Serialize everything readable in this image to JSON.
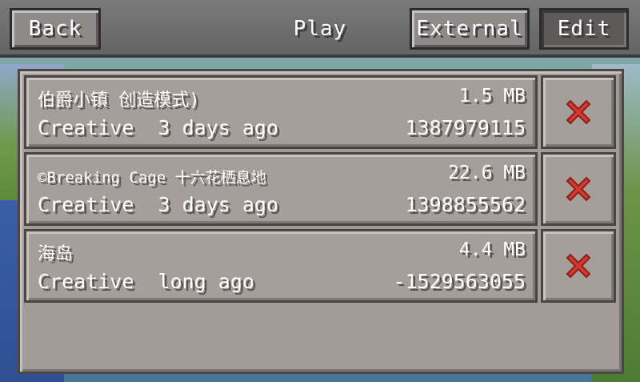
{
  "header": {
    "back_label": "Back",
    "title": "Play",
    "external_label": "External",
    "edit_label": "Edit"
  },
  "worlds": [
    {
      "name": "伯爵小镇 创造模式)",
      "size": "1.5 MB",
      "mode_and_time": "Creative  3 days ago",
      "seed": "1387979115"
    },
    {
      "name": "©Breaking Cage 十六花栖息地",
      "size": "22.6 MB",
      "mode_and_time": "Creative  3 days ago",
      "seed": "1398855562"
    },
    {
      "name": "海岛",
      "size": "4.4 MB",
      "mode_and_time": "Creative  long ago",
      "seed": "-1529563055"
    }
  ],
  "icons": {
    "delete": "red-x-icon"
  },
  "colors": {
    "delete_red": "#d63a2e",
    "panel": "#a29b98"
  }
}
